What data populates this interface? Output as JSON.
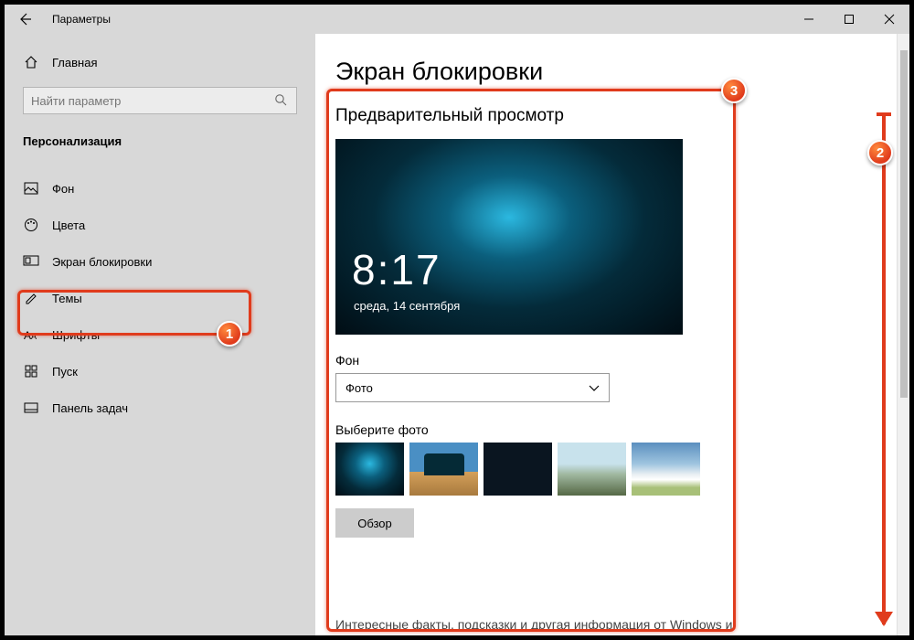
{
  "window": {
    "title": "Параметры"
  },
  "sidebar": {
    "home": "Главная",
    "search_placeholder": "Найти параметр",
    "section": "Персонализация",
    "items": [
      {
        "label": "Фон",
        "icon": "picture-icon"
      },
      {
        "label": "Цвета",
        "icon": "palette-icon"
      },
      {
        "label": "Экран блокировки",
        "icon": "lockscreen-icon"
      },
      {
        "label": "Темы",
        "icon": "themes-icon"
      },
      {
        "label": "Шрифты",
        "icon": "fonts-icon"
      },
      {
        "label": "Пуск",
        "icon": "start-icon"
      },
      {
        "label": "Панель задач",
        "icon": "taskbar-icon"
      }
    ]
  },
  "content": {
    "title": "Экран блокировки",
    "preview_heading": "Предварительный просмотр",
    "preview_time": "8:17",
    "preview_date": "среда, 14 сентября",
    "bg_label": "Фон",
    "bg_value": "Фото",
    "choose_label": "Выберите фото",
    "browse": "Обзор",
    "cutoff_text": "Интересные факты, подсказки и другая информация от Windows и"
  },
  "annotations": {
    "b1": "1",
    "b2": "2",
    "b3": "3"
  }
}
